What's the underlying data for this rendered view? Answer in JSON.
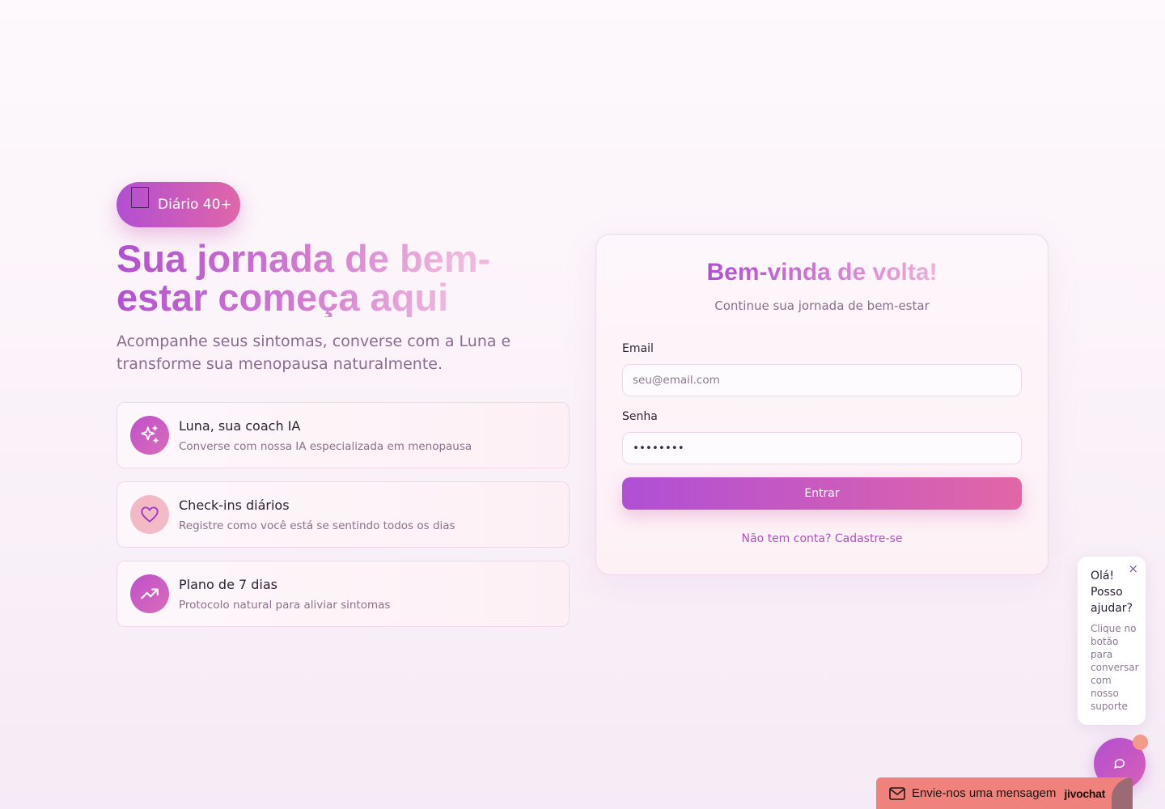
{
  "brand": {
    "name": "Diário 40+",
    "icon": "app-square-icon"
  },
  "hero": {
    "title": "Sua jornada de bem-estar começa aqui",
    "subtitle": "Acompanhe seus sintomas, converse com a Luna e transforme sua menopausa naturalmente."
  },
  "features": [
    {
      "icon": "sparkles-icon",
      "title": "Luna, sua coach IA",
      "description": "Converse com nossa IA especializada em menopausa"
    },
    {
      "icon": "heart-icon",
      "title": "Check-ins diários",
      "description": "Registre como você está se sentindo todos os dias"
    },
    {
      "icon": "trending-up-icon",
      "title": "Plano de 7 dias",
      "description": "Protocolo natural para aliviar sintomas"
    }
  ],
  "login": {
    "title": "Bem-vinda de volta!",
    "subtitle": "Continue sua jornada de bem-estar",
    "email_label": "Email",
    "email_placeholder": "seu@email.com",
    "password_label": "Senha",
    "password_value": "********",
    "submit_label": "Entrar",
    "signup_link": "Não tem conta? Cadastre-se"
  },
  "chat": {
    "greeting": "Olá! Posso ajudar?",
    "help_text": "Clique no botão para conversar com nosso suporte",
    "close_label": "×",
    "send_message_label": "Envie-nos uma mensagem",
    "provider": "jivochat"
  },
  "colors": {
    "accent_purple": "#b14fd0",
    "accent_pink": "#e066a8",
    "chat_bar": "#f0827d"
  }
}
